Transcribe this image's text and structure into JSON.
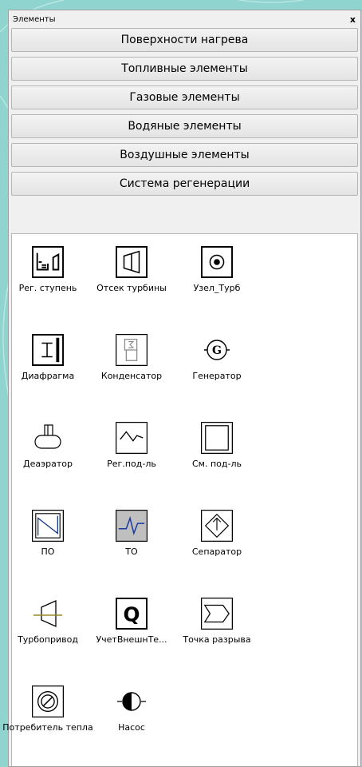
{
  "panel": {
    "title": "Элементы",
    "close_label": "x"
  },
  "categories": [
    {
      "label": "Поверхности нагрева"
    },
    {
      "label": "Топливные элементы"
    },
    {
      "label": "Газовые элементы"
    },
    {
      "label": "Водяные элементы"
    },
    {
      "label": "Воздушные элементы"
    },
    {
      "label": "Система регенерации"
    }
  ],
  "elements": [
    {
      "label": "Рег. ступень",
      "icon": "control-stage-icon"
    },
    {
      "label": "Отсек турбины",
      "icon": "turbine-section-icon"
    },
    {
      "label": "Узел_Турб",
      "icon": "turbine-node-icon"
    },
    {
      "label": "Диафрагма",
      "icon": "diaphragm-icon"
    },
    {
      "label": "Конденсатор",
      "icon": "condenser-icon"
    },
    {
      "label": "Генератор",
      "icon": "generator-icon"
    },
    {
      "label": "Деаэратор",
      "icon": "deaerator-icon"
    },
    {
      "label": "Рег.под-ль",
      "icon": "regenerative-heater-icon"
    },
    {
      "label": "См. под-ль",
      "icon": "mixing-heater-icon"
    },
    {
      "label": "ПО",
      "icon": "po-icon"
    },
    {
      "label": "ТО",
      "icon": "heat-exchanger-icon"
    },
    {
      "label": "Сепаратор",
      "icon": "separator-icon"
    },
    {
      "label": "Турбопривод",
      "icon": "turbo-drive-icon"
    },
    {
      "label": "УчетВнешнТе...",
      "icon": "external-heat-account-icon"
    },
    {
      "label": "Точка разрыва",
      "icon": "break-point-icon"
    },
    {
      "label": "Потребитель тепла",
      "icon": "heat-consumer-icon"
    },
    {
      "label": "Насос",
      "icon": "pump-icon"
    }
  ]
}
